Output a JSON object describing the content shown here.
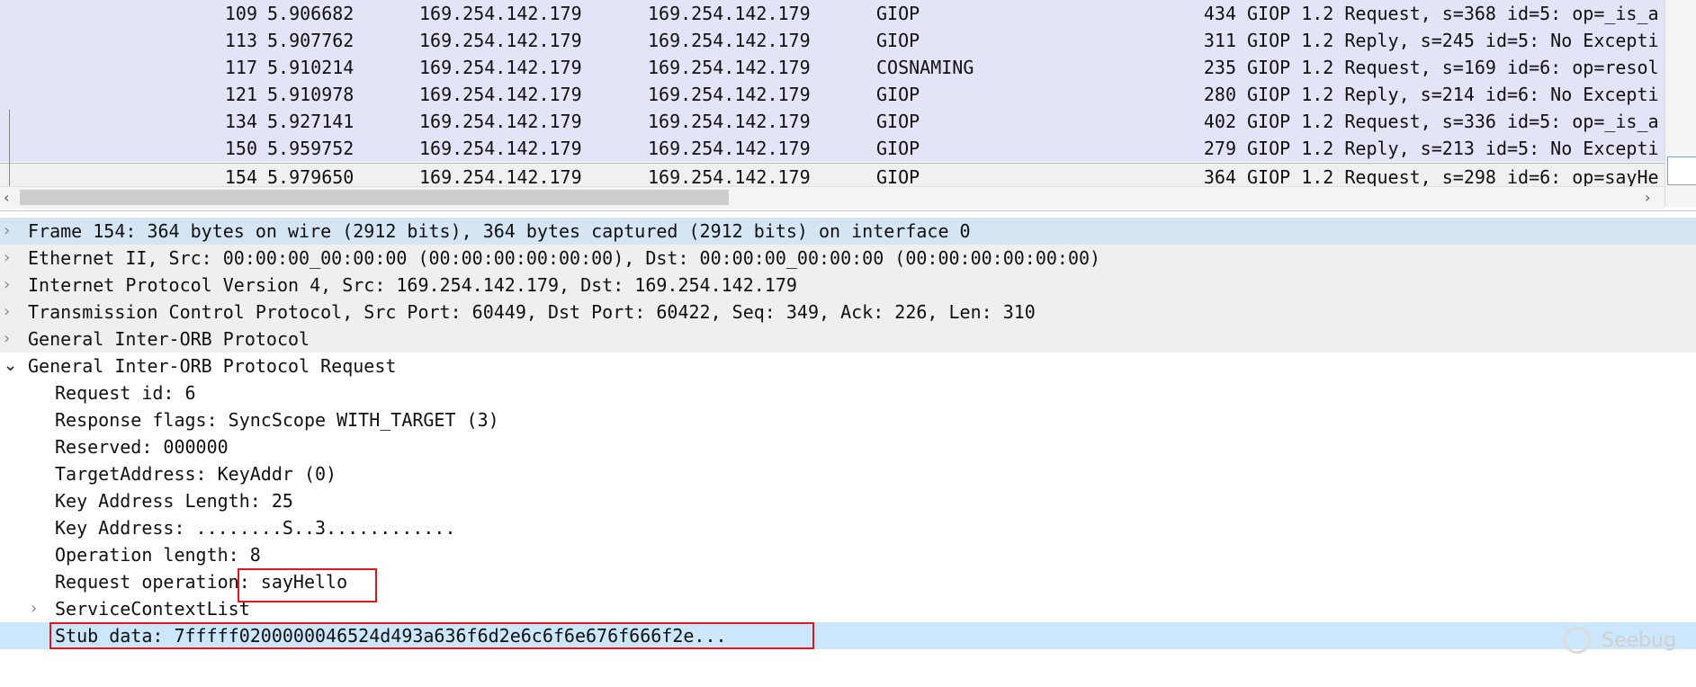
{
  "packet_list": {
    "rows": [
      {
        "no": "109",
        "time": "5.906682",
        "src": "169.254.142.179",
        "dst": "169.254.142.179",
        "proto": "GIOP",
        "len": "434",
        "info": "GIOP 1.2 Request, s=368 id=5: op=_is_a"
      },
      {
        "no": "113",
        "time": "5.907762",
        "src": "169.254.142.179",
        "dst": "169.254.142.179",
        "proto": "GIOP",
        "len": "311",
        "info": "GIOP 1.2 Reply, s=245 id=5: No Excepti"
      },
      {
        "no": "117",
        "time": "5.910214",
        "src": "169.254.142.179",
        "dst": "169.254.142.179",
        "proto": "COSNAMING",
        "len": "235",
        "info": "GIOP 1.2 Request, s=169 id=6: op=resol"
      },
      {
        "no": "121",
        "time": "5.910978",
        "src": "169.254.142.179",
        "dst": "169.254.142.179",
        "proto": "GIOP",
        "len": "280",
        "info": "GIOP 1.2 Reply, s=214 id=6: No Excepti"
      },
      {
        "no": "134",
        "time": "5.927141",
        "src": "169.254.142.179",
        "dst": "169.254.142.179",
        "proto": "GIOP",
        "len": "402",
        "info": "GIOP 1.2 Request, s=336 id=5: op=_is_a"
      },
      {
        "no": "150",
        "time": "5.959752",
        "src": "169.254.142.179",
        "dst": "169.254.142.179",
        "proto": "GIOP",
        "len": "279",
        "info": "GIOP 1.2 Reply, s=213 id=5: No Excepti"
      },
      {
        "no": "154",
        "time": "5.979650",
        "src": "169.254.142.179",
        "dst": "169.254.142.179",
        "proto": "GIOP",
        "len": "364",
        "info": "GIOP 1.2 Request, s=298 id=6: op=sayHe"
      }
    ],
    "selected_index": 6
  },
  "details": {
    "frame": "Frame 154: 364 bytes on wire (2912 bits), 364 bytes captured (2912 bits) on interface 0",
    "ethernet": "Ethernet II, Src: 00:00:00_00:00:00 (00:00:00:00:00:00), Dst: 00:00:00_00:00:00 (00:00:00:00:00:00)",
    "ip": "Internet Protocol Version 4, Src: 169.254.142.179, Dst: 169.254.142.179",
    "tcp": "Transmission Control Protocol, Src Port: 60449, Dst Port: 60422, Seq: 349, Ack: 226, Len: 310",
    "giop": "General Inter-ORB Protocol",
    "giop_request": "General Inter-ORB Protocol Request",
    "request_id": "Request id: 6",
    "response_flags": "Response flags: SyncScope WITH_TARGET (3)",
    "reserved": "Reserved: 000000",
    "target_address": "TargetAddress: KeyAddr (0)",
    "key_address_length": "Key Address Length: 25",
    "key_address": "Key Address: ........S..3............",
    "operation_length": "Operation length: 8",
    "request_operation": "Request operation: sayHello",
    "service_context_list": "ServiceContextList",
    "stub_data": "Stub data: 7fffff0200000046524d493a636f6d2e6c6f6e676f666f2e..."
  },
  "icons": {
    "collapsed": "chevron-right-icon",
    "expanded": "chevron-down-icon",
    "scroll_left": "arrow-left-icon",
    "scroll_right": "arrow-right-icon"
  },
  "watermark": "Seebug",
  "colors": {
    "packet_row_bg": "#e4e4f9",
    "selected_detail_bg": "#cce6fb",
    "frame_row_bg": "#d6e5f3",
    "highlight_box": "#e0171f"
  }
}
